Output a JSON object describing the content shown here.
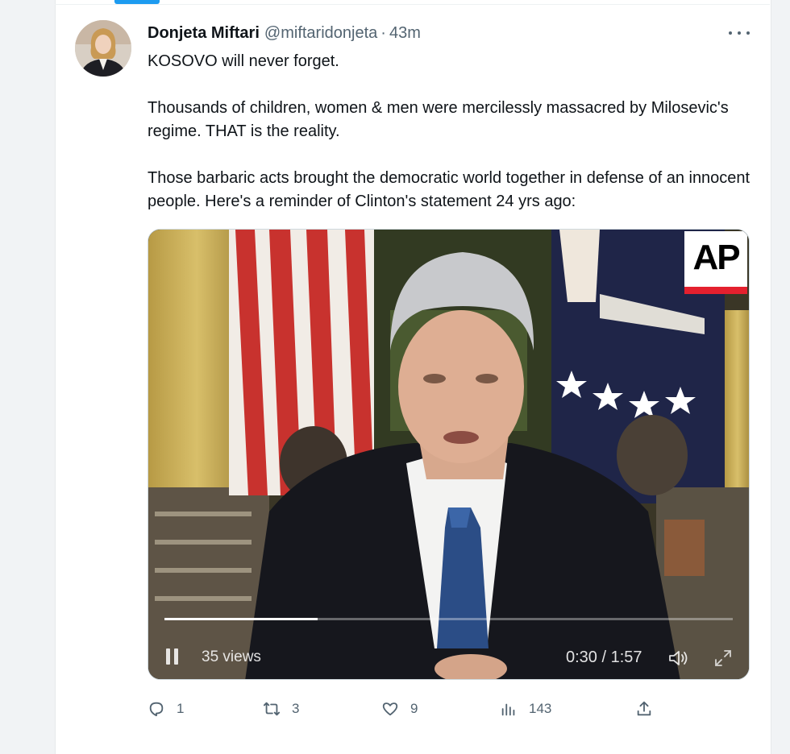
{
  "tweet": {
    "display_name": "Donjeta Miftari",
    "handle": "@miftaridonjeta",
    "separator": "·",
    "time": "43m",
    "paragraphs": [
      "KOSOVO will never forget.",
      "Thousands of children, women & men were mercilessly massacred by Milosevic's regime. THAT is the reality.",
      "Those barbaric acts brought the democratic world together in defense of an innocent people. Here's a reminder of Clinton's statement 24 yrs ago:"
    ]
  },
  "video": {
    "watermark": "AP",
    "views": "35 views",
    "time": "0:30 / 1:57",
    "progress": 0.27
  },
  "actions": {
    "replies": "1",
    "retweets": "3",
    "likes": "9",
    "views": "143"
  },
  "icons": {
    "more": "more-icon",
    "reply": "reply-icon",
    "retweet": "retweet-icon",
    "like": "heart-icon",
    "analytics": "analytics-icon",
    "share": "share-icon",
    "pause": "pause-icon",
    "volume": "volume-icon",
    "fullscreen": "fullscreen-icon"
  },
  "colors": {
    "accent": "#1d9bf0",
    "text": "#0f1419",
    "secondary": "#536471",
    "ap_red": "#e4202e"
  }
}
